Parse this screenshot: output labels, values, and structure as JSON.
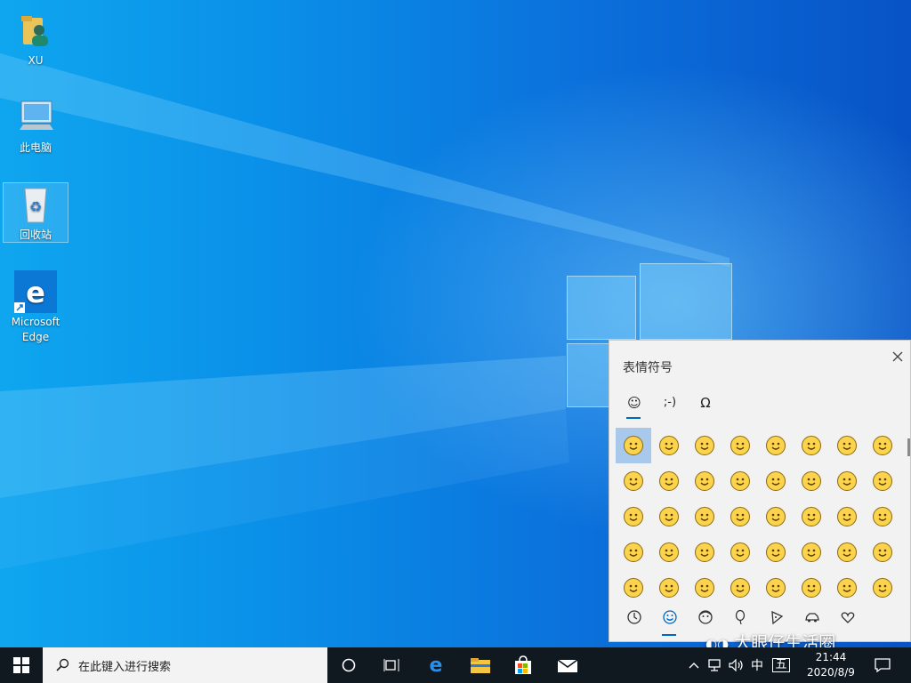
{
  "desktop": {
    "icons": [
      {
        "label": "XU"
      },
      {
        "label": "此电脑"
      },
      {
        "label": "回收站"
      },
      {
        "label": "Microsoft Edge"
      }
    ]
  },
  "emoji_panel": {
    "title": "表情符号",
    "category_tabs": [
      {
        "label": "☺",
        "name": "emoji"
      },
      {
        "label": ";-)",
        "name": "kaomoji"
      },
      {
        "label": "Ω",
        "name": "symbols"
      }
    ],
    "emoji_rows": [
      [
        "😀",
        "😁",
        "😂",
        "🤣",
        "😃",
        "😄",
        "😅",
        "😆"
      ],
      [
        "😉",
        "😊",
        "😋",
        "😎",
        "😍",
        "😘",
        "🥰",
        "🙂"
      ],
      [
        "☺",
        "😚",
        "😊",
        "🙂",
        "🤗",
        "🤩",
        "🤔",
        "🤨"
      ],
      [
        "😐",
        "😑",
        "😶",
        "🙄",
        "😏",
        "😣",
        "😥",
        "😮"
      ],
      [
        "🤐",
        "😯",
        "😪",
        "😫",
        "🥱",
        "😴",
        "😌",
        "😛"
      ]
    ],
    "bottom_tabs": [
      {
        "name": "recent",
        "icon": "clock-icon"
      },
      {
        "name": "smiley",
        "icon": "smiley-icon"
      },
      {
        "name": "people",
        "icon": "person-icon"
      },
      {
        "name": "celebration",
        "icon": "balloon-icon"
      },
      {
        "name": "food",
        "icon": "pizza-icon"
      },
      {
        "name": "transport",
        "icon": "car-icon"
      },
      {
        "name": "love",
        "icon": "heart-icon"
      }
    ]
  },
  "watermark": "大眼仔生活圈",
  "taskbar": {
    "search_placeholder": "在此键入进行搜索",
    "ime_lang": "中",
    "ime_mode": "五",
    "time": "21:44",
    "date": "2020/8/9"
  },
  "colors": {
    "accent": "#0067c0",
    "taskbar": "#101820"
  }
}
